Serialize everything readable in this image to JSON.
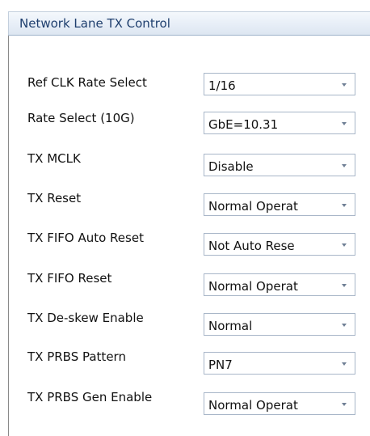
{
  "panel": {
    "title": "Network Lane TX Control"
  },
  "rows": [
    {
      "label": "Ref CLK Rate Select",
      "value": "1/16"
    },
    {
      "label": "Rate Select (10G)",
      "value": "GbE=10.31"
    },
    {
      "label": "TX MCLK",
      "value": "Disable"
    },
    {
      "label": "TX Reset",
      "value": "Normal Operat"
    },
    {
      "label": "TX FIFO Auto Reset",
      "value": "Not Auto Rese"
    },
    {
      "label": "TX FIFO Reset",
      "value": "Normal Operat"
    },
    {
      "label": "TX De-skew Enable",
      "value": "Normal"
    },
    {
      "label": "TX PRBS Pattern",
      "value": "PN7"
    },
    {
      "label": "TX PRBS Gen Enable",
      "value": "Normal Operat"
    }
  ]
}
